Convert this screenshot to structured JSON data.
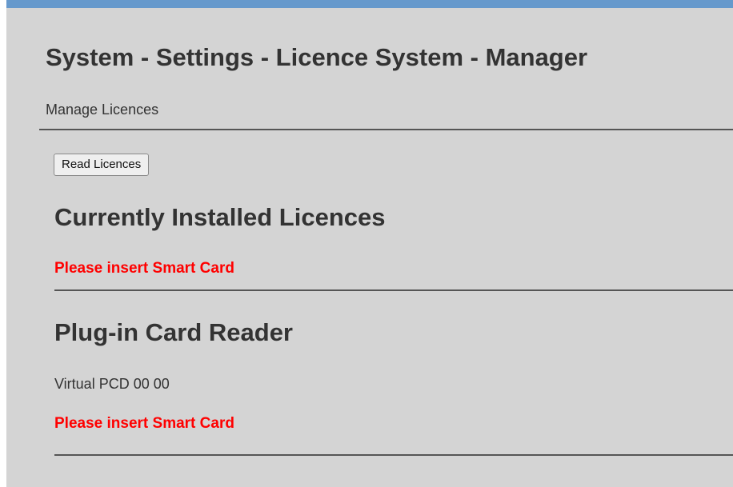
{
  "header": {
    "title": "System - Settings - Licence System - Manager",
    "subtitle": "Manage Licences"
  },
  "actions": {
    "read_licences_label": "Read Licences"
  },
  "installed_licences": {
    "heading": "Currently Installed Licences",
    "message": "Please insert Smart Card"
  },
  "card_reader": {
    "heading": "Plug-in Card Reader",
    "reader_name": "Virtual PCD 00 00",
    "message": "Please insert Smart Card"
  },
  "colors": {
    "top_bar": "#6699cc",
    "background": "#d4d4d4",
    "text": "#333333",
    "alert": "#ff0000"
  }
}
